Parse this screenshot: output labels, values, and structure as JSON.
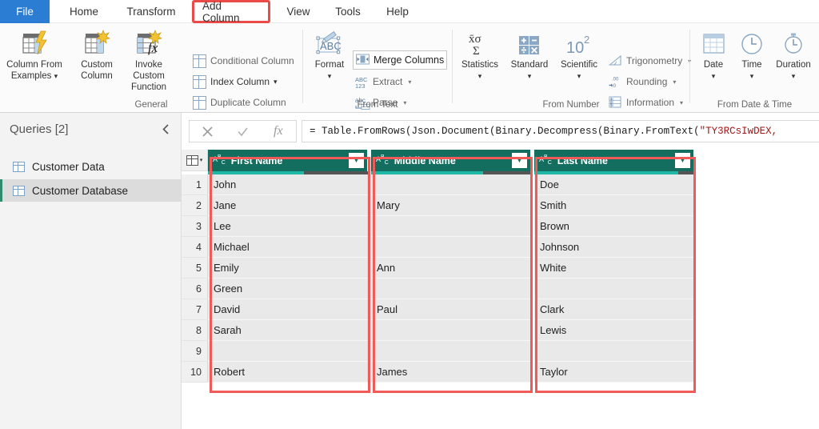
{
  "ribbon": {
    "tabs": [
      {
        "label": "File",
        "id": "file"
      },
      {
        "label": "Home",
        "id": "home"
      },
      {
        "label": "Transform",
        "id": "transform"
      },
      {
        "label": "Add Column",
        "id": "add-column"
      },
      {
        "label": "View",
        "id": "view"
      },
      {
        "label": "Tools",
        "id": "tools"
      },
      {
        "label": "Help",
        "id": "help"
      }
    ],
    "active_tab": "Add Column",
    "highlight_color": "#ea4a48",
    "groups": [
      {
        "name": "General",
        "label": "General",
        "big_buttons": [
          {
            "label_1": "Column From",
            "label_2": "Examples",
            "icon": "column-from-examples-icon",
            "has_caret": true
          },
          {
            "label_1": "Custom",
            "label_2": "Column",
            "icon": "custom-column-icon",
            "has_caret": false
          },
          {
            "label_1": "Invoke Custom",
            "label_2": "Function",
            "icon": "invoke-custom-function-icon",
            "has_caret": false
          }
        ],
        "small_buttons": [
          {
            "label": "Conditional Column",
            "icon": "conditional-column-icon",
            "has_caret": false,
            "disabled": true
          },
          {
            "label": "Index Column",
            "icon": "index-column-icon",
            "has_caret": true,
            "disabled": false
          },
          {
            "label": "Duplicate Column",
            "icon": "duplicate-column-icon",
            "has_caret": false,
            "disabled": true
          }
        ]
      },
      {
        "name": "From Text",
        "label": "From Text",
        "big_buttons": [
          {
            "label_1": "Format",
            "label_2": "",
            "icon": "format-abc-icon",
            "has_caret": true
          }
        ],
        "small_buttons": [
          {
            "label": "Merge Columns",
            "icon": "merge-columns-icon",
            "has_caret": false,
            "boxed": true
          },
          {
            "label": "Extract",
            "icon": "extract-abc123-icon",
            "has_caret": true
          },
          {
            "label": "Parse",
            "icon": "parse-abc-icon",
            "has_caret": true
          }
        ]
      },
      {
        "name": "From Number",
        "label": "From Number",
        "big_buttons": [
          {
            "label_1": "Statistics",
            "label_2": "",
            "icon": "statistics-sigma-icon",
            "has_caret": true
          },
          {
            "label_1": "Standard",
            "label_2": "",
            "icon": "standard-operators-icon",
            "has_caret": true
          },
          {
            "label_1": "Scientific",
            "label_2": "",
            "icon": "scientific-power-icon",
            "has_caret": true
          }
        ],
        "small_buttons": [
          {
            "label": "Trigonometry",
            "icon": "trigonometry-icon",
            "has_caret": true
          },
          {
            "label": "Rounding",
            "icon": "rounding-icon",
            "has_caret": true
          },
          {
            "label": "Information",
            "icon": "information-icon",
            "has_caret": true
          }
        ]
      },
      {
        "name": "From Date & Time",
        "label": "From Date & Time",
        "big_buttons": [
          {
            "label_1": "Date",
            "label_2": "",
            "icon": "calendar-icon",
            "has_caret": true
          },
          {
            "label_1": "Time",
            "label_2": "",
            "icon": "clock-icon",
            "has_caret": true
          },
          {
            "label_1": "Duration",
            "label_2": "",
            "icon": "stopwatch-icon",
            "has_caret": true
          }
        ],
        "small_buttons": []
      }
    ]
  },
  "queries_pane": {
    "title": "Queries [2]",
    "collapse_icon": "chevron-left-icon",
    "items": [
      {
        "label": "Customer Data",
        "icon": "table-icon",
        "active": false
      },
      {
        "label": "Customer Database",
        "icon": "table-icon",
        "active": true
      }
    ]
  },
  "formula_bar": {
    "cancel_icon": "close-icon",
    "accept_icon": "check-icon",
    "fx_icon": "fx-icon",
    "formula_prefix": "= Table.FromRows(Json.Document(Binary.Decompress(Binary.FromText(",
    "formula_string": "\"TY3RCsIwDEX,"
  },
  "table": {
    "select_all_icon": "select-all-table-icon",
    "columns": [
      {
        "name": "First Name",
        "type_icon": "abc-text-type-icon",
        "quality_good_pct": 60,
        "highlighted": true
      },
      {
        "name": "Middle Name",
        "type_icon": "abc-text-type-icon",
        "quality_good_pct": 70,
        "highlighted": true
      },
      {
        "name": "Last Name",
        "type_icon": "abc-text-type-icon",
        "quality_good_pct": 90,
        "highlighted": true
      }
    ],
    "header_color": "#136e5f",
    "quality_good_color": "#1fb8a6",
    "quality_bar_color": "#555555",
    "rows": [
      {
        "n": "1",
        "cells": [
          "John",
          "",
          "Doe"
        ]
      },
      {
        "n": "2",
        "cells": [
          "Jane",
          "Mary",
          "Smith"
        ]
      },
      {
        "n": "3",
        "cells": [
          "Lee",
          "",
          "Brown"
        ]
      },
      {
        "n": "4",
        "cells": [
          "Michael",
          "",
          "Johnson"
        ]
      },
      {
        "n": "5",
        "cells": [
          "Emily",
          "Ann",
          "White"
        ]
      },
      {
        "n": "6",
        "cells": [
          "Green",
          "",
          ""
        ]
      },
      {
        "n": "7",
        "cells": [
          "David",
          "Paul",
          "Clark"
        ]
      },
      {
        "n": "8",
        "cells": [
          "Sarah",
          "",
          "Lewis"
        ]
      },
      {
        "n": "9",
        "cells": [
          "",
          "",
          ""
        ]
      },
      {
        "n": "10",
        "cells": [
          "Robert",
          "James",
          "Taylor"
        ]
      }
    ]
  }
}
